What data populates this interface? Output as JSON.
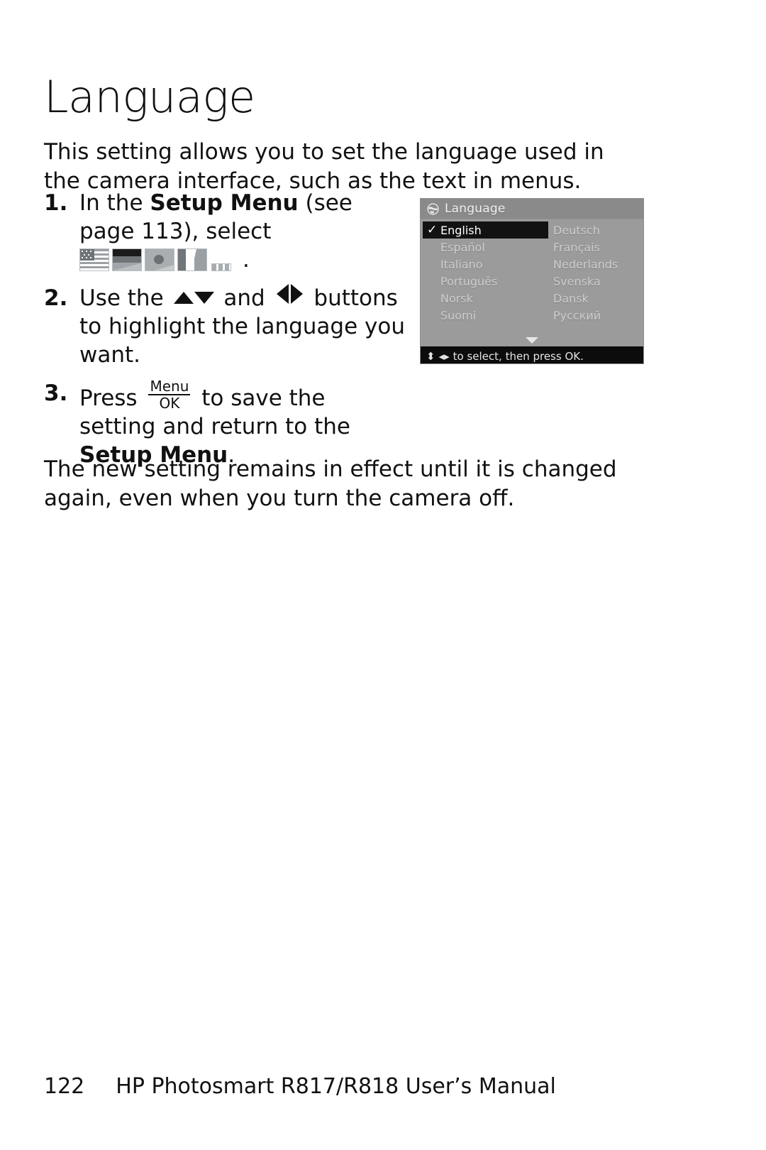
{
  "document": {
    "title": "Language",
    "intro": "This setting allows you to set the language used in the camera interface, such as the text in menus.",
    "closing": "The new setting remains in effect until it is changed again, even when you turn the camera off."
  },
  "steps": [
    {
      "number": "1.",
      "text_before": "In the ",
      "bold_1": "Setup Menu",
      "text_mid": " (see page 113), select",
      "icon": "language-flags-icon",
      "text_after": "."
    },
    {
      "number": "2.",
      "text_before": "Use the ",
      "icon_updown": "up-down-arrows-icon",
      "text_mid": " and ",
      "icon_leftright": "left-right-arrows-icon",
      "text_after": " buttons to highlight the language you want."
    },
    {
      "number": "3.",
      "text_before": "Press ",
      "button_menu": "Menu",
      "button_ok": "OK",
      "text_mid": " to save the setting and return to the ",
      "bold_1": "Setup Menu",
      "text_after": "."
    }
  ],
  "lcd": {
    "header_icon": "globe-icon",
    "header_title": "Language",
    "columns": {
      "left": [
        {
          "label": "English",
          "selected": true,
          "check": "✓"
        },
        {
          "label": "Español",
          "selected": false
        },
        {
          "label": "Italiano",
          "selected": false
        },
        {
          "label": "Português",
          "selected": false
        },
        {
          "label": "Norsk",
          "selected": false
        },
        {
          "label": "Suomi",
          "selected": false
        }
      ],
      "right": [
        {
          "label": "Deutsch",
          "selected": false
        },
        {
          "label": "Français",
          "selected": false
        },
        {
          "label": "Nederlands",
          "selected": false
        },
        {
          "label": "Svenska",
          "selected": false
        },
        {
          "label": "Dansk",
          "selected": false
        },
        {
          "label": "Русский",
          "selected": false
        }
      ]
    },
    "scroll_indicator": "scroll-down-arrow",
    "footer_hint_vertical": "⬍",
    "footer_hint_horizontal": "◂▸",
    "footer_text": "to select, then press OK."
  },
  "footer": {
    "page_number": "122",
    "manual_title": "HP Photosmart R817/R818 User’s Manual"
  },
  "colors": {
    "text": "#111111",
    "lcd_background": "#9b9b9b",
    "lcd_header": "#8a8a8a",
    "lcd_selected": "#121212",
    "lcd_footer": "#0c0c0c",
    "lcd_item_text": "#cdcdcd"
  }
}
